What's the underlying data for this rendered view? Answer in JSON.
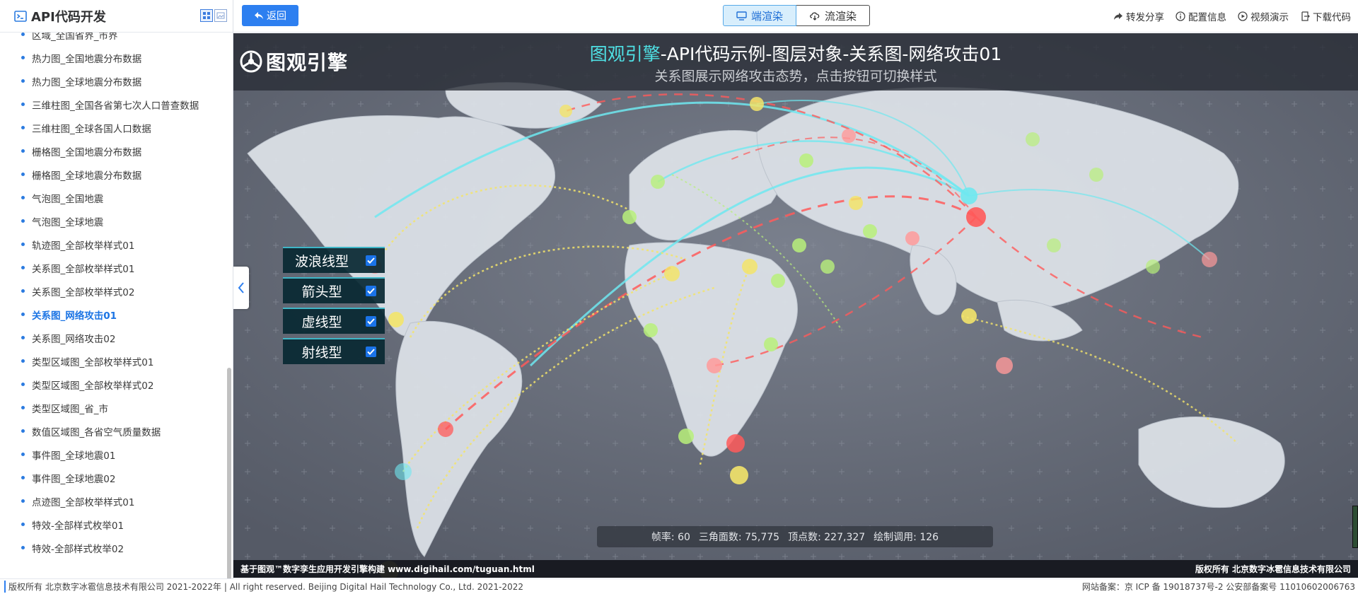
{
  "sidebar": {
    "title": "API代码开发",
    "items": [
      {
        "label": "区域_全国省界_市界",
        "active": false
      },
      {
        "label": "热力图_全国地震分布数据",
        "active": false
      },
      {
        "label": "热力图_全球地震分布数据",
        "active": false
      },
      {
        "label": "三维柱图_全国各省第七次人口普查数据",
        "active": false
      },
      {
        "label": "三维柱图_全球各国人口数据",
        "active": false
      },
      {
        "label": "栅格图_全国地震分布数据",
        "active": false
      },
      {
        "label": "栅格图_全球地震分布数据",
        "active": false
      },
      {
        "label": "气泡图_全国地震",
        "active": false
      },
      {
        "label": "气泡图_全球地震",
        "active": false
      },
      {
        "label": "轨迹图_全部枚举样式01",
        "active": false
      },
      {
        "label": "关系图_全部枚举样式01",
        "active": false
      },
      {
        "label": "关系图_全部枚举样式02",
        "active": false
      },
      {
        "label": "关系图_网络攻击01",
        "active": true
      },
      {
        "label": "关系图_网络攻击02",
        "active": false
      },
      {
        "label": "类型区域图_全部枚举样式01",
        "active": false
      },
      {
        "label": "类型区域图_全部枚举样式02",
        "active": false
      },
      {
        "label": "类型区域图_省_市",
        "active": false
      },
      {
        "label": "数值区域图_各省空气质量数据",
        "active": false
      },
      {
        "label": "事件图_全球地震01",
        "active": false
      },
      {
        "label": "事件图_全球地震02",
        "active": false
      },
      {
        "label": "点迹图_全部枚举样式01",
        "active": false
      },
      {
        "label": "特效-全部样式枚举01",
        "active": false
      },
      {
        "label": "特效-全部样式枚举02",
        "active": false
      }
    ]
  },
  "topbar": {
    "back_label": "返回",
    "render_tabs": [
      {
        "label": "端渲染",
        "icon": "monitor-icon",
        "active": true
      },
      {
        "label": "流渲染",
        "icon": "cloud-download-icon",
        "active": false
      }
    ],
    "links": [
      {
        "label": "转发分享",
        "icon": "share-icon"
      },
      {
        "label": "配置信息",
        "icon": "info-icon"
      },
      {
        "label": "视频演示",
        "icon": "play-icon"
      },
      {
        "label": "下载代码",
        "icon": "download-icon"
      }
    ]
  },
  "map": {
    "logo_text": "图观引擎",
    "title_brand": "图观引擎",
    "title_rest": "-API代码示例-图层对象-关系图-网络攻击01",
    "subtitle": "关系图展示网络攻击态势，点击按钮可切换样式",
    "style_buttons": [
      {
        "label": "波浪线型",
        "checked": true
      },
      {
        "label": "箭头型",
        "checked": true
      },
      {
        "label": "虚线型",
        "checked": true
      },
      {
        "label": "射线型",
        "checked": true
      }
    ],
    "stats": {
      "fps_label": "帧率:",
      "fps": "60",
      "tri_label": "三角面数:",
      "tri": "75,775",
      "vert_label": "顶点数:",
      "vert": "227,327",
      "draw_label": "绘制调用:",
      "draw": "126"
    },
    "footer_left": "基于图观™数字孪生应用开发引擎构建 www.digihail.com/tuguan.html",
    "footer_right": "版权所有 北京数字冰雹信息技术有限公司",
    "colors": {
      "accent": "#4fe1e5",
      "line_cyan": "#6fe8f0",
      "line_red": "#ff5a5a",
      "line_yellow": "#f3e46a",
      "node_green": "#b8f07a"
    }
  },
  "bottom": {
    "left": "版权所有 北京数字冰雹信息技术有限公司 2021-2022年 | All right reserved. Beijing Digital Hail Technology Co., Ltd. 2021-2022",
    "right": "网站备案：京 ICP 备 19018737号-2 公安部备案号 11010602006763"
  }
}
